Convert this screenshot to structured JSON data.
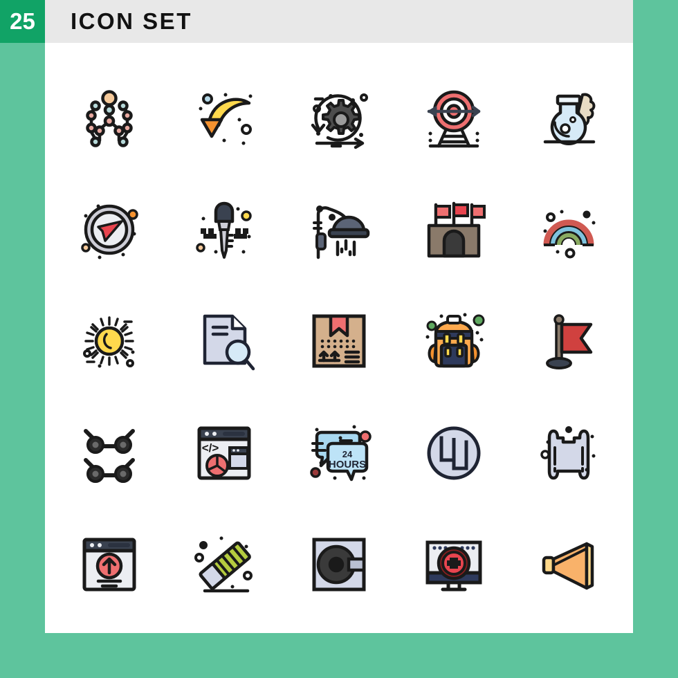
{
  "header": {
    "count": "25",
    "title": "ICON SET",
    "badge_color": "#11a366",
    "strip_color": "#e8e8e8",
    "background_color": "#5ec49d",
    "card_color": "#ffffff"
  },
  "grid": {
    "columns": 5,
    "rows": 5,
    "total_icons": 25,
    "style": "filled line / flat line-color icon set"
  },
  "icons": [
    {
      "row": 1,
      "col": 1,
      "name": "network-person-nodes-icon",
      "label": "Connection",
      "colors": [
        "#f5c99a",
        "#b6d9d9",
        "#e8a9a0",
        "#1a1a1a"
      ]
    },
    {
      "row": 1,
      "col": 2,
      "name": "meteor-arrow-down-icon",
      "label": "Shooting Star",
      "colors": [
        "#ffd94d",
        "#f5922f",
        "#b6d9e8",
        "#1a1a1a"
      ]
    },
    {
      "row": 1,
      "col": 3,
      "name": "gear-process-cycle-icon",
      "label": "Settings",
      "colors": [
        "#4d4d4d",
        "#9b9b9b",
        "#1a1a1a"
      ]
    },
    {
      "row": 1,
      "col": 4,
      "name": "target-arrow-icon",
      "label": "Target",
      "colors": [
        "#ee6f70",
        "#ffffff",
        "#3a4250",
        "#1a1a1a"
      ]
    },
    {
      "row": 1,
      "col": 5,
      "name": "chemistry-flask-smoke-icon",
      "label": "Flask",
      "colors": [
        "#d6eaf7",
        "#e8dcc4",
        "#1a1a1a"
      ]
    },
    {
      "row": 2,
      "col": 1,
      "name": "compass-navigation-icon",
      "label": "Compass",
      "colors": [
        "#cdcdd6",
        "#eceef2",
        "#e8454f",
        "#f5922f",
        "#1a1a1a"
      ]
    },
    {
      "row": 2,
      "col": 2,
      "name": "key-icon",
      "label": "Key",
      "colors": [
        "#3a4250",
        "#cdcdd6",
        "#ffd94d",
        "#1a1a1a"
      ]
    },
    {
      "row": 2,
      "col": 3,
      "name": "shower-head-icon",
      "label": "Shower",
      "colors": [
        "#5b6476",
        "#3a4250",
        "#1a1a1a"
      ]
    },
    {
      "row": 2,
      "col": 4,
      "name": "castle-fort-flags-icon",
      "label": "Fort",
      "colors": [
        "#8a7a6a",
        "#e8454f",
        "#ee6f70",
        "#3a3a3a",
        "#1a1a1a"
      ]
    },
    {
      "row": 2,
      "col": 5,
      "name": "rainbow-icon",
      "label": "Rainbow",
      "colors": [
        "#d05a52",
        "#7fc3de",
        "#8aab62",
        "#1a1a1a"
      ]
    },
    {
      "row": 3,
      "col": 1,
      "name": "sun-icon",
      "label": "Sun",
      "colors": [
        "#ffd94d",
        "#1a1a1a"
      ]
    },
    {
      "row": 3,
      "col": 2,
      "name": "document-search-icon",
      "label": "File Search",
      "colors": [
        "#d3d8e8",
        "#d6eaf7",
        "#1f2433"
      ]
    },
    {
      "row": 3,
      "col": 3,
      "name": "package-box-icon",
      "label": "Package",
      "colors": [
        "#d4b08c",
        "#ee6f70",
        "#1a1a1a"
      ]
    },
    {
      "row": 3,
      "col": 4,
      "name": "backpack-icon",
      "label": "Backpack",
      "colors": [
        "#f5922f",
        "#ffa94d",
        "#2e3a5c",
        "#ffd94d",
        "#5fa860",
        "#1a1a1a"
      ]
    },
    {
      "row": 3,
      "col": 5,
      "name": "flag-pole-icon",
      "label": "Flag",
      "colors": [
        "#d0413f",
        "#8a7a6a",
        "#3a4250",
        "#1a1a1a"
      ]
    },
    {
      "row": 4,
      "col": 1,
      "name": "skateboard-trucks-icon",
      "label": "Skate Trucks",
      "colors": [
        "#2b2b2b",
        "#1a1a1a"
      ]
    },
    {
      "row": 4,
      "col": 2,
      "name": "web-development-window-icon",
      "label": "Web Dev",
      "colors": [
        "#eceef2",
        "#3a4250",
        "#ee6f70",
        "#d3d8e8",
        "#1a1a1a"
      ]
    },
    {
      "row": 4,
      "col": 3,
      "name": "chat-24-hours-icon",
      "label": "24 Hours Support",
      "text": "24 HOURS",
      "colors": [
        "#a8d8f0",
        "#bde3f7",
        "#ee6f70",
        "#9b3a3a",
        "#1a1a1a"
      ]
    },
    {
      "row": 4,
      "col": 4,
      "name": "square-wave-circle-icon",
      "label": "Square Wave",
      "colors": [
        "#d3d8e8",
        "#1f2433"
      ]
    },
    {
      "row": 4,
      "col": 5,
      "name": "scroll-parchment-icon",
      "label": "Scroll",
      "colors": [
        "#d3d8e8",
        "#1a1a1a"
      ]
    },
    {
      "row": 5,
      "col": 1,
      "name": "browser-upload-icon",
      "label": "Upload",
      "colors": [
        "#eceef2",
        "#3a4250",
        "#ee6f70",
        "#1a1a1a"
      ]
    },
    {
      "row": 5,
      "col": 2,
      "name": "eraser-icon",
      "label": "Eraser",
      "colors": [
        "#b5cc3f",
        "#d3d8e8",
        "#eceef2",
        "#1a1a1a"
      ]
    },
    {
      "row": 5,
      "col": 3,
      "name": "disk-vault-icon",
      "label": "Safe",
      "colors": [
        "#d3d8e8",
        "#3a3a3a",
        "#b9c0d2",
        "#1a1a1a"
      ]
    },
    {
      "row": 5,
      "col": 4,
      "name": "monitor-medical-plus-icon",
      "label": "Online Health",
      "colors": [
        "#eceef2",
        "#2e3a5c",
        "#e8454f",
        "#8a1f1f",
        "#1a1a1a"
      ]
    },
    {
      "row": 5,
      "col": 5,
      "name": "megaphone-cone-icon",
      "label": "Megaphone",
      "colors": [
        "#f9b26a",
        "#ffd98a",
        "#1a1a1a"
      ]
    }
  ]
}
